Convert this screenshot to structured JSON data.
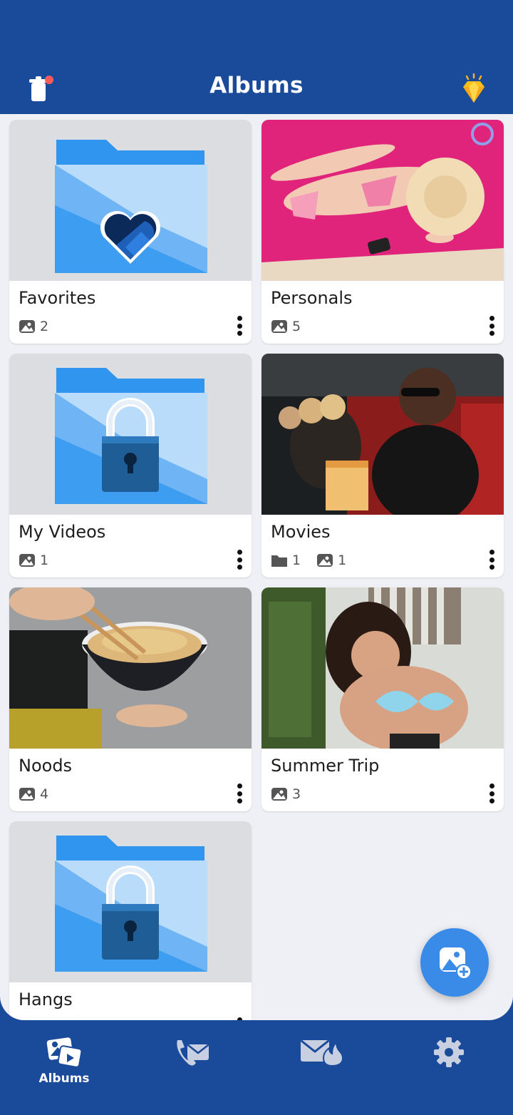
{
  "header": {
    "title": "Albums",
    "trash_icon": "trash-icon",
    "premium_icon": "diamond-icon",
    "notification_dot_color": "#ff5a5a"
  },
  "albums": [
    {
      "name": "Favorites",
      "thumbnail": "folder-heart-icon",
      "photos": "2"
    },
    {
      "name": "Personals",
      "thumbnail": "photo",
      "photos": "5"
    },
    {
      "name": "My Videos",
      "thumbnail": "folder-lock-icon",
      "photos": "1"
    },
    {
      "name": "Movies",
      "thumbnail": "photo",
      "folders": "1",
      "photos": "1"
    },
    {
      "name": "Noods",
      "thumbnail": "photo",
      "photos": "4"
    },
    {
      "name": "Summer Trip",
      "thumbnail": "photo",
      "photos": "3"
    },
    {
      "name": "Hangs",
      "thumbnail": "folder-lock-icon"
    }
  ],
  "fab": {
    "icon": "add-photo-icon"
  },
  "bottom_nav": {
    "albums_label": "Albums",
    "items": [
      "albums-icon",
      "phone-mail-icon",
      "mail-fire-icon",
      "gear-icon"
    ]
  },
  "colors": {
    "brand_blue": "#1a4a9a",
    "background": "#eff0f5",
    "folder_light": "#b9dcfb",
    "folder_dark": "#2f95ee",
    "fab_blue": "#3a8ae8"
  }
}
